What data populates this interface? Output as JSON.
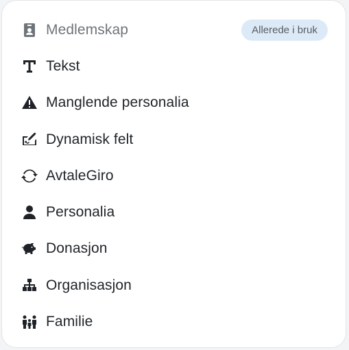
{
  "menu": {
    "items": [
      {
        "label": "Medlemskap",
        "icon": "contact-card-icon",
        "disabled": true,
        "badge": "Allerede i bruk"
      },
      {
        "label": "Tekst",
        "icon": "text-icon"
      },
      {
        "label": "Manglende personalia",
        "icon": "warning-icon"
      },
      {
        "label": "Dynamisk felt",
        "icon": "signature-pen-icon"
      },
      {
        "label": "AvtaleGiro",
        "icon": "recurring-refresh-icon"
      },
      {
        "label": "Personalia",
        "icon": "user-icon"
      },
      {
        "label": "Donasjon",
        "icon": "piggy-bank-icon"
      },
      {
        "label": "Organisasjon",
        "icon": "org-chart-icon"
      },
      {
        "label": "Familie",
        "icon": "family-icon"
      }
    ]
  },
  "colors": {
    "text": "#1f2328",
    "muted_text": "#6f747a",
    "badge_bg": "#dceaf8",
    "panel_border": "#e2e4e8"
  }
}
